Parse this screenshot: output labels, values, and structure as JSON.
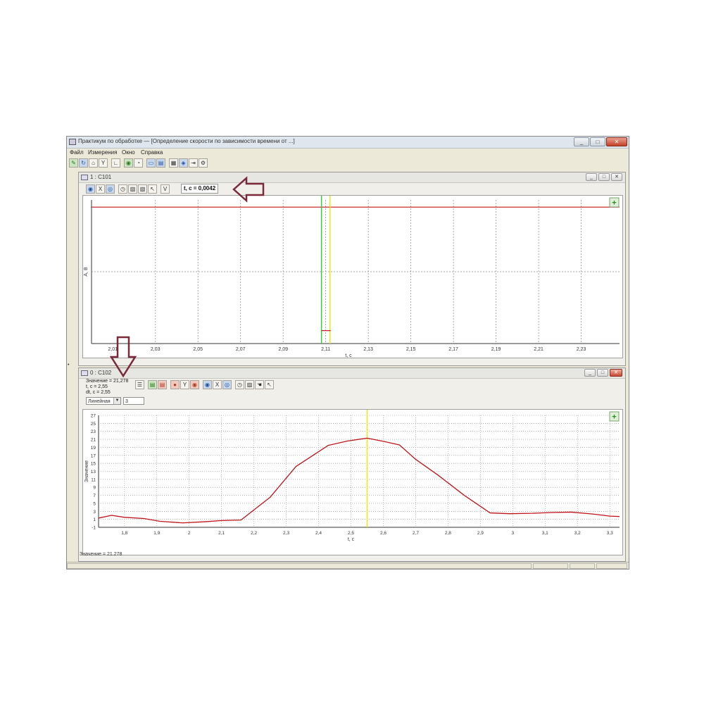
{
  "window": {
    "title": "Практикум по обработке — [Определение скорости по зависимости времени от ...]",
    "controls": [
      "_",
      "□",
      "✕"
    ]
  },
  "menu": [
    "Файл",
    "Измерения",
    "Окно",
    "Справка"
  ],
  "panel1": {
    "title": "1 : C101",
    "readout": "t, c = 0,0042",
    "controls": [
      "_",
      "□",
      "✕"
    ],
    "ylabel": "A, B",
    "xlabel": "t, c",
    "xticks": [
      "2,01",
      "2,03",
      "2,05",
      "2,07",
      "2,09",
      "2,11",
      "2,13",
      "2,15",
      "2,17",
      "2,19",
      "2,21",
      "2,23"
    ]
  },
  "panel2": {
    "title": "0 : C102",
    "info_lines": [
      "Значение = 21,278",
      "t, c = 2,55",
      "dt, c = 2,55"
    ],
    "combo_value": "Линейная",
    "field_value": "3",
    "status": "Значение = 21.278",
    "controls": [
      "_",
      "□",
      "✕"
    ]
  },
  "colors": {
    "trace": "#c0141a",
    "cursor_green": "#3cc83c",
    "cursor_yellow": "#f2e21a",
    "grid": "#8a8a8a",
    "annotation_arrow": "#7a2a3a"
  },
  "chart_data": [
    {
      "type": "line",
      "title": "",
      "xlabel": "t, c",
      "ylabel": "A, B",
      "x_ticks": [
        "2,01",
        "2,03",
        "2,05",
        "2,07",
        "2,09",
        "2,11",
        "2,13",
        "2,15",
        "2,17",
        "2,19",
        "2,21",
        "2,23"
      ],
      "xlim": [
        2.0,
        2.248
      ],
      "ylim": [
        0,
        1
      ],
      "series": [
        {
          "x": [
            2.0,
            2.248
          ],
          "y": [
            0.95,
            0.95
          ]
        }
      ],
      "cursors": [
        2.108,
        2.112
      ],
      "grid": true
    },
    {
      "type": "line",
      "title": "",
      "xlabel": "t, c",
      "ylabel": "Значение",
      "x_ticks": [
        "1,8",
        "1,9",
        "2",
        "2,1",
        "2,2",
        "2,3",
        "2,4",
        "2,5",
        "2,6",
        "2,7",
        "2,8",
        "2,9",
        "3",
        "3,1",
        "3,2",
        "3,3"
      ],
      "y_ticks": [
        "-1",
        "1",
        "3",
        "5",
        "7",
        "9",
        "11",
        "13",
        "15",
        "17",
        "19",
        "21",
        "23",
        "25",
        "27"
      ],
      "xlim": [
        1.72,
        3.33
      ],
      "ylim": [
        -1,
        27
      ],
      "series": [
        {
          "x": [
            1.72,
            1.76,
            1.8,
            1.86,
            1.91,
            1.98,
            2.05,
            2.1,
            2.16,
            2.25,
            2.33,
            2.43,
            2.49,
            2.55,
            2.6,
            2.65,
            2.7,
            2.77,
            2.85,
            2.93,
            2.99,
            3.06,
            3.12,
            3.18,
            3.25,
            3.3,
            3.33
          ],
          "y": [
            1.3,
            2.0,
            1.5,
            1.2,
            0.5,
            0.1,
            0.4,
            0.7,
            0.8,
            6.5,
            14.2,
            19.5,
            20.6,
            21.3,
            20.5,
            19.6,
            16.0,
            12.0,
            7.0,
            2.6,
            2.4,
            2.5,
            2.7,
            2.8,
            2.3,
            1.8,
            1.7
          ]
        }
      ],
      "cursor_x": 2.55,
      "grid": true
    }
  ]
}
